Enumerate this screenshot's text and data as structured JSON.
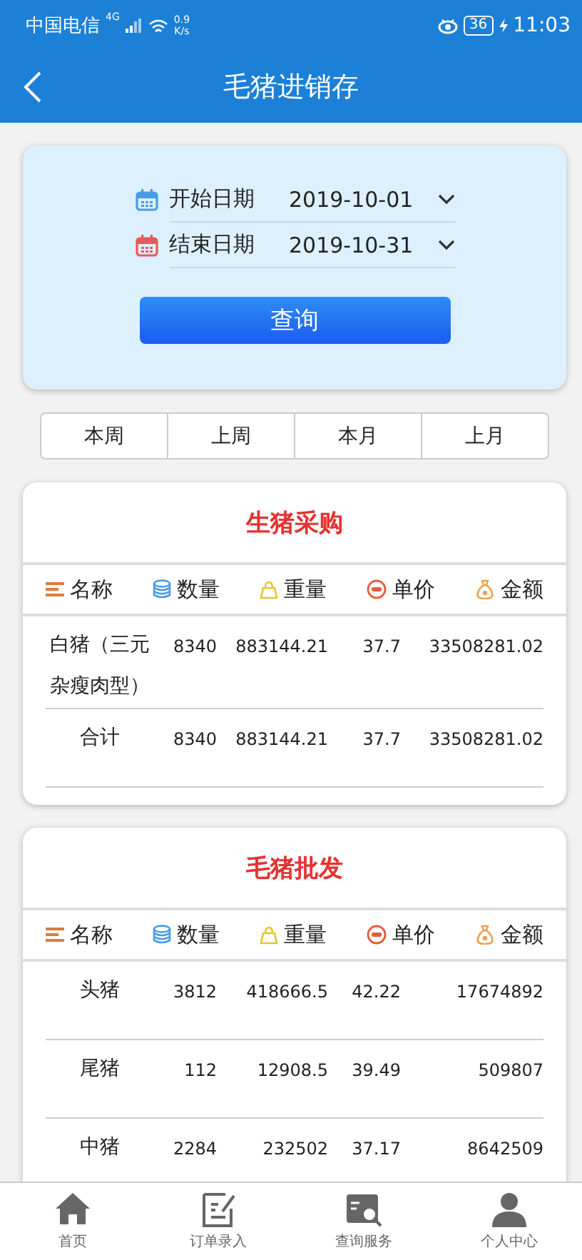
{
  "status_bar": {
    "carrier": "中国电信",
    "network": "4G",
    "speed_value": "0.9",
    "speed_unit": "K/s",
    "battery": "36",
    "time": "11:03"
  },
  "header": {
    "title": "毛猪进销存"
  },
  "filter": {
    "dates": [
      {
        "label": "开始日期",
        "value": "2019-10-01",
        "color": "#4a9be8"
      },
      {
        "label": "结束日期",
        "value": "2019-10-31",
        "color": "#e85a5a"
      }
    ],
    "button": "查询"
  },
  "quick_ranges": [
    "本周",
    "上周",
    "本月",
    "上月"
  ],
  "sections": [
    {
      "title": "生猪采购",
      "columns": [
        {
          "label": "名称",
          "kind": "list"
        },
        {
          "label": "数量",
          "kind": "stack"
        },
        {
          "label": "重量",
          "kind": "weight"
        },
        {
          "label": "单价",
          "kind": "price"
        },
        {
          "label": "金额",
          "kind": "bag"
        }
      ],
      "rows": [
        {
          "cells": [
            "白猪（三元杂瘦肉型）",
            "8340",
            "883144.21",
            "37.7",
            "33508281.02"
          ]
        },
        {
          "cells": [
            "合计",
            "8340",
            "883144.21",
            "37.7",
            "33508281.02"
          ]
        }
      ]
    },
    {
      "title": "毛猪批发",
      "columns": [
        {
          "label": "名称",
          "kind": "list"
        },
        {
          "label": "数量",
          "kind": "stack"
        },
        {
          "label": "重量",
          "kind": "weight"
        },
        {
          "label": "单价",
          "kind": "price"
        },
        {
          "label": "金额",
          "kind": "bag"
        }
      ],
      "rows": [
        {
          "cells": [
            "头猪",
            "3812",
            "418666.5",
            "42.22",
            "17674892"
          ]
        },
        {
          "cells": [
            "尾猪",
            "112",
            "12908.5",
            "39.49",
            "509807"
          ]
        },
        {
          "cells": [
            "中猪",
            "2284",
            "232502",
            "37.17",
            "8642509"
          ]
        }
      ]
    }
  ],
  "bottom_nav": [
    {
      "label": "首页",
      "kind": "home"
    },
    {
      "label": "订单录入",
      "kind": "order"
    },
    {
      "label": "查询服务",
      "kind": "query"
    },
    {
      "label": "个人中心",
      "kind": "user"
    }
  ]
}
